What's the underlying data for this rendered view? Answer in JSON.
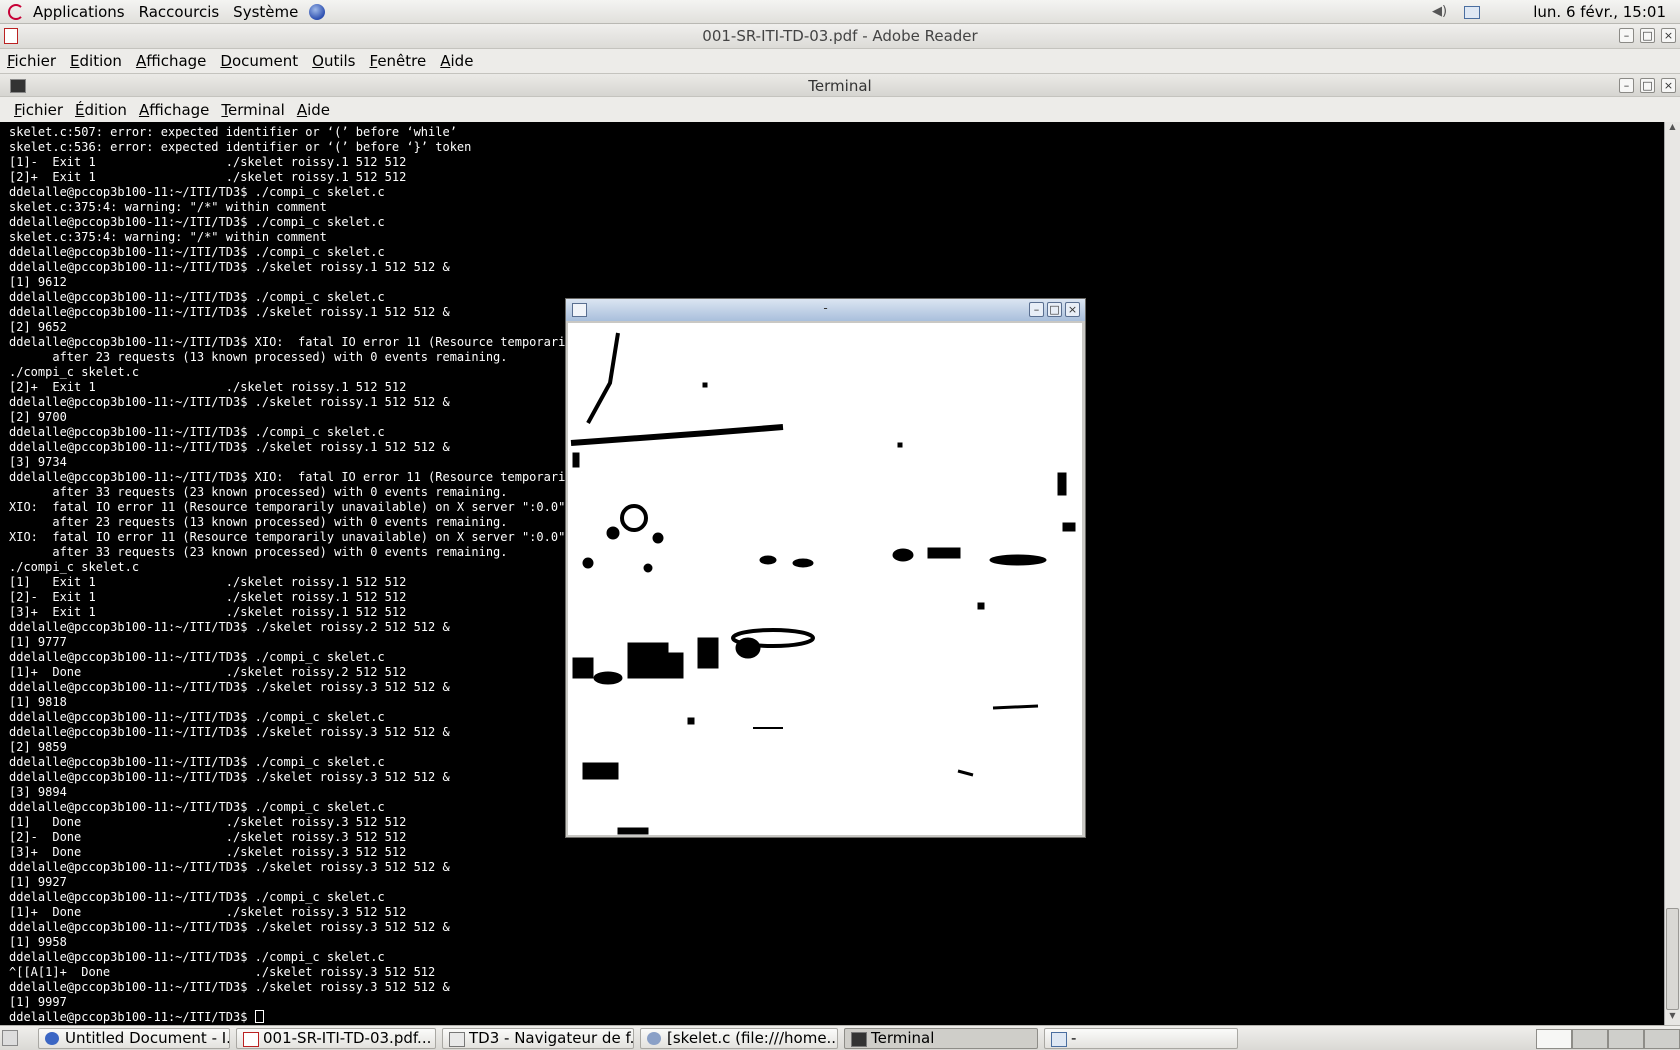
{
  "top_panel": {
    "menus": [
      "Applications",
      "Raccourcis",
      "Système"
    ],
    "clock": "lun. 6 févr., 15:01"
  },
  "reader": {
    "title": "001-SR-ITI-TD-03.pdf - Adobe Reader",
    "menus": [
      "Fichier",
      "Edition",
      "Affichage",
      "Document",
      "Outils",
      "Fenêtre",
      "Aide"
    ]
  },
  "terminal": {
    "title": "Terminal",
    "menus": [
      "Fichier",
      "Édition",
      "Affichage",
      "Terminal",
      "Aide"
    ],
    "lines": [
      "skelet.c:507: error: expected identifier or ‘(’ before ‘while’",
      "skelet.c:536: error: expected identifier or ‘(’ before ‘}’ token",
      "[1]-  Exit 1                  ./skelet roissy.1 512 512",
      "[2]+  Exit 1                  ./skelet roissy.1 512 512",
      "ddelalle@pccop3b100-11:~/ITI/TD3$ ./compi_c skelet.c",
      "skelet.c:375:4: warning: \"/*\" within comment",
      "ddelalle@pccop3b100-11:~/ITI/TD3$ ./compi_c skelet.c",
      "skelet.c:375:4: warning: \"/*\" within comment",
      "ddelalle@pccop3b100-11:~/ITI/TD3$ ./compi_c skelet.c",
      "ddelalle@pccop3b100-11:~/ITI/TD3$ ./skelet roissy.1 512 512 &",
      "[1] 9612",
      "ddelalle@pccop3b100-11:~/ITI/TD3$ ./compi_c skelet.c",
      "ddelalle@pccop3b100-11:~/ITI/TD3$ ./skelet roissy.1 512 512 &",
      "[2] 9652",
      "ddelalle@pccop3b100-11:~/ITI/TD3$ XIO:  fatal IO error 11 (Resource temporarily",
      "      after 23 requests (13 known processed) with 0 events remaining.",
      "./compi_c skelet.c",
      "[2]+  Exit 1                  ./skelet roissy.1 512 512",
      "ddelalle@pccop3b100-11:~/ITI/TD3$ ./skelet roissy.1 512 512 &",
      "[2] 9700",
      "ddelalle@pccop3b100-11:~/ITI/TD3$ ./compi_c skelet.c",
      "ddelalle@pccop3b100-11:~/ITI/TD3$ ./skelet roissy.1 512 512 &",
      "[3] 9734",
      "ddelalle@pccop3b100-11:~/ITI/TD3$ XIO:  fatal IO error 11 (Resource temporarily",
      "      after 33 requests (23 known processed) with 0 events remaining.",
      "XIO:  fatal IO error 11 (Resource temporarily unavailable) on X server \":0.0\"",
      "      after 23 requests (13 known processed) with 0 events remaining.",
      "XIO:  fatal IO error 11 (Resource temporarily unavailable) on X server \":0.0\"",
      "      after 33 requests (23 known processed) with 0 events remaining.",
      "./compi_c skelet.c",
      "[1]   Exit 1                  ./skelet roissy.1 512 512",
      "[2]-  Exit 1                  ./skelet roissy.1 512 512",
      "[3]+  Exit 1                  ./skelet roissy.1 512 512",
      "ddelalle@pccop3b100-11:~/ITI/TD3$ ./skelet roissy.2 512 512 &",
      "[1] 9777",
      "ddelalle@pccop3b100-11:~/ITI/TD3$ ./compi_c skelet.c",
      "[1]+  Done                    ./skelet roissy.2 512 512",
      "ddelalle@pccop3b100-11:~/ITI/TD3$ ./skelet roissy.3 512 512 &",
      "[1] 9818",
      "ddelalle@pccop3b100-11:~/ITI/TD3$ ./compi_c skelet.c",
      "ddelalle@pccop3b100-11:~/ITI/TD3$ ./skelet roissy.3 512 512 &",
      "[2] 9859",
      "ddelalle@pccop3b100-11:~/ITI/TD3$ ./compi_c skelet.c",
      "ddelalle@pccop3b100-11:~/ITI/TD3$ ./skelet roissy.3 512 512 &",
      "[3] 9894",
      "ddelalle@pccop3b100-11:~/ITI/TD3$ ./compi_c skelet.c",
      "[1]   Done                    ./skelet roissy.3 512 512",
      "[2]-  Done                    ./skelet roissy.3 512 512",
      "[3]+  Done                    ./skelet roissy.3 512 512",
      "ddelalle@pccop3b100-11:~/ITI/TD3$ ./skelet roissy.3 512 512 &",
      "[1] 9927",
      "ddelalle@pccop3b100-11:~/ITI/TD3$ ./compi_c skelet.c",
      "[1]+  Done                    ./skelet roissy.3 512 512",
      "ddelalle@pccop3b100-11:~/ITI/TD3$ ./skelet roissy.3 512 512 &",
      "[1] 9958",
      "ddelalle@pccop3b100-11:~/ITI/TD3$ ./compi_c skelet.c",
      "^[[A[1]+  Done                    ./skelet roissy.3 512 512",
      "ddelalle@pccop3b100-11:~/ITI/TD3$ ./skelet roissy.3 512 512 &",
      "[1] 9997"
    ],
    "prompt": "ddelalle@pccop3b100-11:~/ITI/TD3$ "
  },
  "image_window": {
    "title": "-"
  },
  "taskbar": {
    "tasks": [
      {
        "label": "Untitled Document - I...",
        "icon": "browser-icon"
      },
      {
        "label": "001-SR-ITI-TD-03.pdf...",
        "icon": "pdf-icon"
      },
      {
        "label": "TD3 - Navigateur de f...",
        "icon": "folder-icon"
      },
      {
        "label": "[skelet.c (file:///home...",
        "icon": "editor-icon"
      },
      {
        "label": "Terminal",
        "icon": "terminal-icon"
      },
      {
        "label": "-",
        "icon": "window-icon"
      }
    ]
  },
  "colors": {
    "terminal_bg": "#000000",
    "terminal_fg": "#ffffff",
    "panel": "#e8e7e3",
    "image_titlebar": "#bccde4"
  }
}
